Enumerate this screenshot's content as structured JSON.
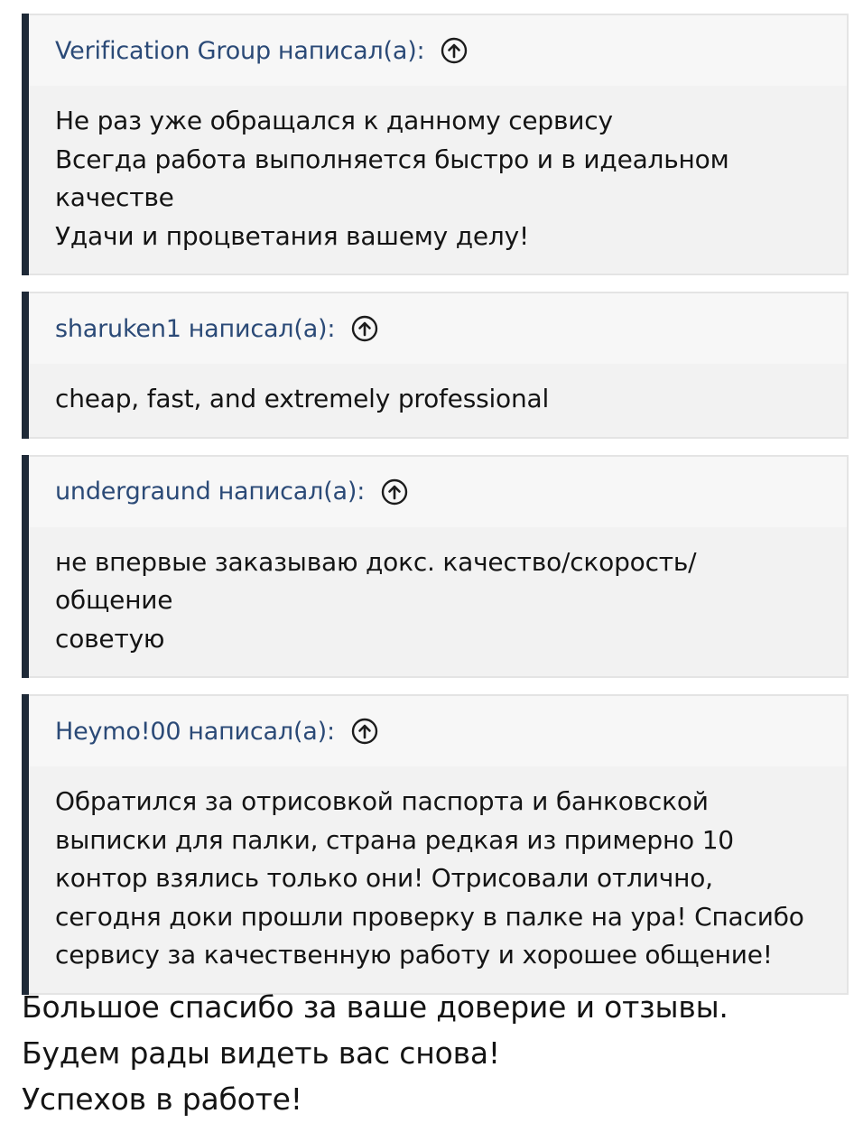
{
  "quotes": [
    {
      "author": "Verification Group",
      "wrote_label": "написал(а):",
      "lines": [
        "Не раз уже обращался к данному сервису",
        "Всегда работа выполняется быстро и в идеальном",
        "качестве",
        "Удачи и процветания вашему делу!"
      ]
    },
    {
      "author": "sharuken1",
      "wrote_label": "написал(а):",
      "lines": [
        "cheap, fast, and extremely professional"
      ]
    },
    {
      "author": "undergraund",
      "wrote_label": "написал(а):",
      "lines": [
        "не впервые заказываю докс. качество/скорость/",
        "общение",
        "советую"
      ]
    },
    {
      "author": "Heymo!00",
      "wrote_label": "написал(а):",
      "lines": [
        "Обратился за отрисовкой паспорта и банковской",
        "выписки для палки, страна редкая из примерно 10",
        "контор взялись только они! Отрисовали отлично,",
        "сегодня доки прошли проверку в палке на ура! Спасибо",
        "сервису за качественную работу и хорошее общение!"
      ]
    }
  ],
  "reply": {
    "lines": [
      "Большое спасибо за ваше доверие и отзывы.",
      "Будем рады видеть вас снова!",
      "Успехов в работе!"
    ]
  },
  "icons": {
    "jump_to_post": "arrow-up-circle-icon"
  }
}
